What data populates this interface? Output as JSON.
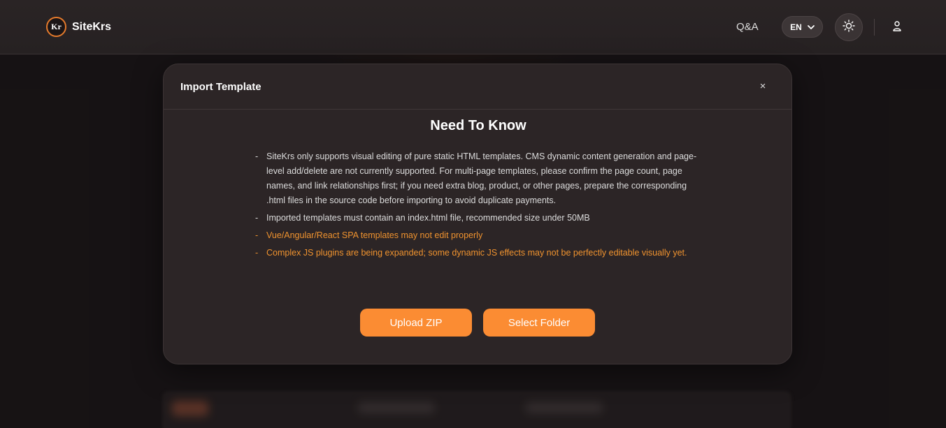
{
  "header": {
    "logo_badge": "Kr",
    "brand": "SiteKrs",
    "qa_label": "Q&A",
    "language": "EN"
  },
  "modal": {
    "title": "Import Template",
    "close_label": "×",
    "heading": "Need To Know",
    "notes": [
      "SiteKrs only supports visual editing of pure static HTML templates. CMS dynamic content generation and page-level add/delete are not currently supported. For multi-page templates, please confirm the page count, page names, and link relationships first; if you need extra blog, product, or other pages, prepare the corresponding .html files in the source code before importing to avoid duplicate payments.",
      "Imported templates must contain an index.html file, recommended size under 50MB",
      "Vue/Angular/React SPA templates may not edit properly",
      "Complex JS plugins are being expanded; some dynamic JS effects may not be perfectly editable visually yet."
    ],
    "upload_zip_label": "Upload ZIP",
    "select_folder_label": "Select Folder"
  },
  "colors": {
    "accent": "#fb8c33",
    "warning_text": "#f0932f",
    "background": "#1a1617",
    "modal_bg": "#2c2526"
  },
  "icons": {
    "theme": "sun-icon",
    "user": "user-icon",
    "dropdown": "chevron-down-icon",
    "close": "close-icon"
  }
}
